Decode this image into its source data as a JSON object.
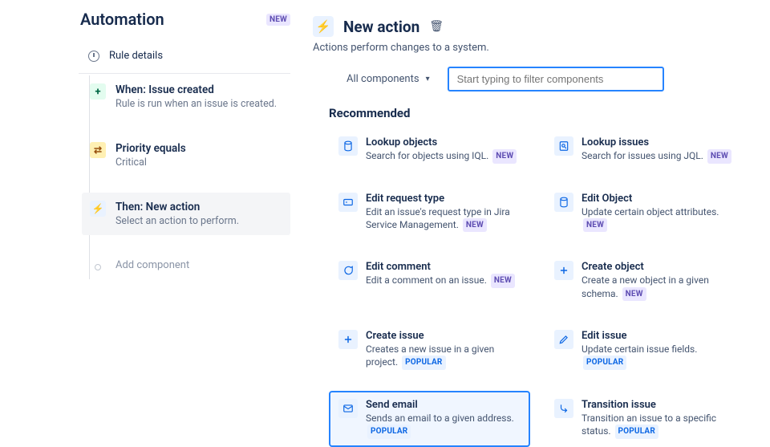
{
  "page_title": "Automation",
  "page_badge": "NEW",
  "rule_details_label": "Rule details",
  "steps": {
    "when": {
      "title": "When: Issue created",
      "sub": "Rule is run when an issue is created."
    },
    "cond": {
      "title": "Priority equals",
      "sub": "Critical"
    },
    "then": {
      "title": "Then: New action",
      "sub": "Select an action to perform."
    },
    "add": {
      "label": "Add component"
    }
  },
  "action_header": {
    "title": "New action",
    "subtitle": "Actions perform changes to a system."
  },
  "filter": {
    "dropdown_label": "All components",
    "search_placeholder": "Start typing to filter components"
  },
  "recommended_label": "Recommended",
  "cards": [
    {
      "title": "Lookup objects",
      "desc": "Search for objects using IQL.",
      "badge": "NEW",
      "badge_type": "new",
      "icon": "db"
    },
    {
      "title": "Lookup issues",
      "desc": "Search for issues using JQL.",
      "badge": "NEW",
      "badge_type": "new",
      "icon": "search-doc"
    },
    {
      "title": "Edit request type",
      "desc": "Edit an issue's request type in Jira Service Management.",
      "badge": "NEW",
      "badge_type": "new",
      "icon": "form"
    },
    {
      "title": "Edit Object",
      "desc": "Update certain object attributes.",
      "badge": "NEW",
      "badge_type": "new",
      "icon": "db"
    },
    {
      "title": "Edit comment",
      "desc": "Edit a comment on an issue.",
      "badge": "NEW",
      "badge_type": "new",
      "icon": "comment"
    },
    {
      "title": "Create object",
      "desc": "Create a new object in a given schema.",
      "badge": "NEW",
      "badge_type": "new",
      "icon": "plus"
    },
    {
      "title": "Create issue",
      "desc": "Creates a new issue in a given project.",
      "badge": "POPULAR",
      "badge_type": "popular",
      "icon": "plus"
    },
    {
      "title": "Edit issue",
      "desc": "Update certain issue fields.",
      "badge": "POPULAR",
      "badge_type": "popular",
      "icon": "pencil"
    },
    {
      "title": "Send email",
      "desc": "Sends an email to a given address.",
      "badge": "POPULAR",
      "badge_type": "popular",
      "icon": "mail",
      "selected": true
    },
    {
      "title": "Transition issue",
      "desc": "Transition an issue to a specific status.",
      "badge": "POPULAR",
      "badge_type": "popular",
      "icon": "branch"
    }
  ]
}
